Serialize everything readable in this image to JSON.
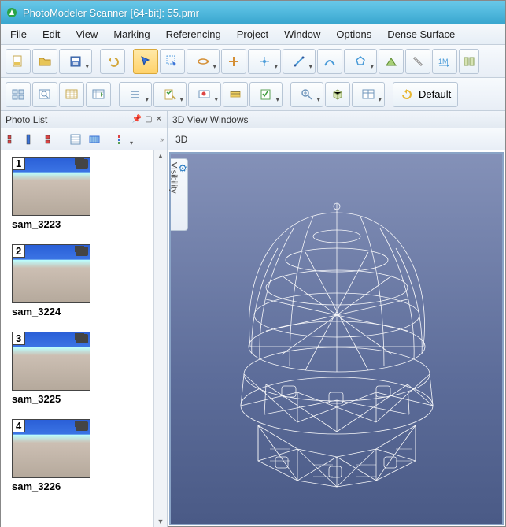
{
  "title": "PhotoModeler Scanner [64-bit]: 55.pmr",
  "menu": [
    "File",
    "Edit",
    "View",
    "Marking",
    "Referencing",
    "Project",
    "Window",
    "Options",
    "Dense Surface"
  ],
  "toolbar1_icons": [
    "new-project",
    "open-project",
    "save",
    "undo",
    "select",
    "region-select",
    "rotate-view",
    "pan-view",
    "point-mode",
    "line-mode",
    "curve-mode",
    "shape-mode",
    "surface-mode",
    "measure",
    "scale",
    "references"
  ],
  "toolbar2_icons": [
    "window-layout",
    "open-photo",
    "open-table",
    "photo-table",
    "list",
    "mark",
    "idealize",
    "color",
    "quality",
    "zoom",
    "mode3d",
    "table-view"
  ],
  "layout_label": "Default",
  "panels": {
    "left_title": "Photo List",
    "right_title": "3D View Windows",
    "view_label": "3D",
    "visibility_label": "Visibility"
  },
  "left_toolbar_icons": [
    "thumbs-small",
    "thumbs-tall",
    "thumbs-med",
    "details",
    "chips",
    "sort"
  ],
  "photos": [
    {
      "index": "1",
      "name": "sam_3223"
    },
    {
      "index": "2",
      "name": "sam_3224"
    },
    {
      "index": "3",
      "name": "sam_3225"
    },
    {
      "index": "4",
      "name": "sam_3226"
    }
  ]
}
